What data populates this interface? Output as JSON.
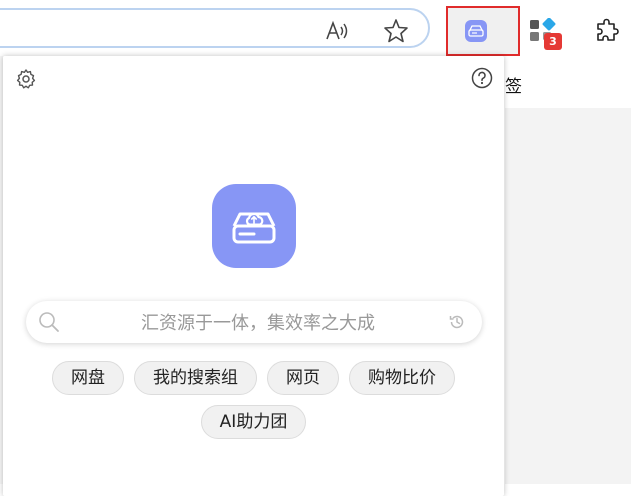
{
  "toolbar": {
    "extension_badge_count": "3",
    "bookmark_fragment": "签"
  },
  "popup": {
    "search": {
      "placeholder": "汇资源于一体，集效率之大成"
    },
    "chips_row1": [
      "网盘",
      "我的搜索组",
      "网页",
      "购物比价"
    ],
    "chips_row2": [
      "AI助力团"
    ],
    "colors": {
      "accent": "#8796f5",
      "highlight_border": "#e02b2b",
      "badge": "#e53935"
    },
    "icons": [
      "settings-icon",
      "help-icon",
      "cloud-drive-icon",
      "search-icon",
      "history-icon"
    ]
  }
}
